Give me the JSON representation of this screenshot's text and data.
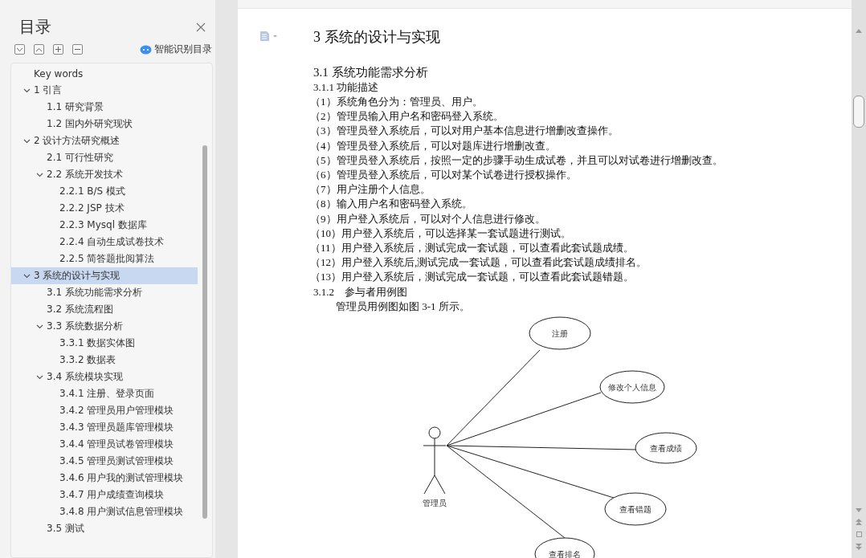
{
  "toc": {
    "title": "目录",
    "smart_button": "智能识别目录",
    "items": [
      {
        "label": "Key words",
        "selected": false
      },
      {
        "label": "1  引言",
        "expanded": true,
        "selected": false,
        "children": [
          {
            "label": "1.1  研究背景",
            "selected": false
          },
          {
            "label": "1.2  国内外研究现状",
            "selected": false
          }
        ]
      },
      {
        "label": "2  设计方法研究概述",
        "expanded": true,
        "selected": false,
        "children": [
          {
            "label": "2.1  可行性研究",
            "selected": false
          },
          {
            "label": "2.2  系统开发技术",
            "expanded": true,
            "selected": false,
            "children": [
              {
                "label": "2.2.1    B/S 模式",
                "selected": false
              },
              {
                "label": "2.2.2 JSP 技术",
                "selected": false
              },
              {
                "label": "2.2.3 Mysql 数据库",
                "selected": false
              },
              {
                "label": "2.2.4  自动生成试卷技术",
                "selected": false
              },
              {
                "label": "2.2.5  简答题批阅算法",
                "selected": false
              }
            ]
          }
        ]
      },
      {
        "label": "3  系统的设计与实现",
        "expanded": true,
        "selected": true,
        "children": [
          {
            "label": "3.1  系统功能需求分析",
            "selected": false
          },
          {
            "label": "3.2  系统流程图",
            "selected": false
          },
          {
            "label": "3.3  系统数据分析",
            "expanded": true,
            "selected": false,
            "children": [
              {
                "label": "3.3.1    数据实体图",
                "selected": false
              },
              {
                "label": "3.3.2    数据表",
                "selected": false
              }
            ]
          },
          {
            "label": "3.4  系统模块实现",
            "expanded": true,
            "selected": false,
            "children": [
              {
                "label": "3.4.1  注册、登录页面",
                "selected": false
              },
              {
                "label": "3.4.2  管理员用户管理模块",
                "selected": false
              },
              {
                "label": "3.4.3  管理员题库管理模块",
                "selected": false
              },
              {
                "label": "3.4.4  管理员试卷管理模块",
                "selected": false
              },
              {
                "label": "3.4.5  管理员测试管理模块",
                "selected": false
              },
              {
                "label": "3.4.6 用户我的测试管理模块",
                "selected": false
              },
              {
                "label": "3.4.7 用户成绩查询模块",
                "selected": false
              },
              {
                "label": "3.4.8 用户测试信息管理模块",
                "selected": false
              }
            ]
          },
          {
            "label": "3.5  测试",
            "selected": false
          }
        ]
      }
    ]
  },
  "document": {
    "heading": "3  系统的设计与实现",
    "section": "3.1  系统功能需求分析",
    "subsections": [
      {
        "title": "3.1.1 功能描述",
        "kind": "list",
        "paragraphs": [
          "（1）系统角色分为：管理员、用户。",
          "（2）管理员输入用户名和密码登入系统。",
          "（3）管理员登入系统后，可以对用户基本信息进行增删改查操作。",
          "（4）管理员登入系统后，可以对题库进行增删改查。",
          "（5）管理员登入系统后，按照一定的步骤手动生成试卷，并且可以对试卷进行增删改查。",
          "（6）管理员登入系统后，可以对某个试卷进行授权操作。",
          "（7）用户注册个人信息。",
          "（8）输入用户名和密码登入系统。",
          "（9）用户登入系统后，可以对个人信息进行修改。",
          "（10）用户登入系统后，可以选择某一套试题进行测试。",
          "（11）用户登入系统后，测试完成一套试题，可以查看此套试题成绩。",
          "（12）用户登入系统后,测试完成一套试题，可以查看此套试题成绩排名。",
          "（13）用户登入系统后，测试完成一套试题，可以查看此套试题错题。"
        ]
      },
      {
        "title": "3.1.2　参与者用例图",
        "kind": "indented",
        "paragraphs": [
          "管理员用例图如图 3-1 所示。"
        ]
      }
    ],
    "diagram": {
      "actor": "管理员",
      "use_cases": [
        "注册",
        "修改个人信息",
        "查看成绩",
        "查看错题",
        "查看排名"
      ]
    }
  }
}
